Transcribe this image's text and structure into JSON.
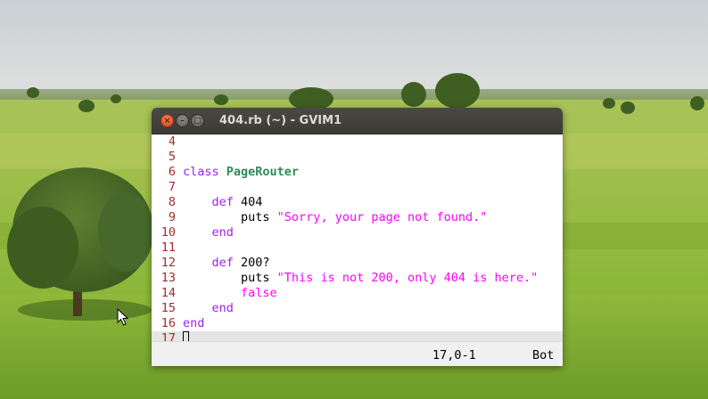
{
  "window": {
    "title": "404.rb (~) - GVIM1",
    "close_symbol": "×",
    "minimize_symbol": "–",
    "maximize_symbol": "□"
  },
  "editor": {
    "lines": [
      {
        "num": "4",
        "tokens": []
      },
      {
        "num": "5",
        "tokens": []
      },
      {
        "num": "6",
        "tokens": [
          {
            "t": "class",
            "c": "kw"
          },
          {
            "t": " "
          },
          {
            "t": "PageRouter",
            "c": "cls"
          }
        ]
      },
      {
        "num": "7",
        "tokens": []
      },
      {
        "num": "8",
        "tokens": [
          {
            "t": "    "
          },
          {
            "t": "def",
            "c": "kw"
          },
          {
            "t": " 404"
          }
        ]
      },
      {
        "num": "9",
        "tokens": [
          {
            "t": "        puts "
          },
          {
            "t": "\"Sorry, your page not found.\"",
            "c": "str"
          }
        ]
      },
      {
        "num": "10",
        "tokens": [
          {
            "t": "    "
          },
          {
            "t": "end",
            "c": "kw"
          }
        ]
      },
      {
        "num": "11",
        "tokens": []
      },
      {
        "num": "12",
        "tokens": [
          {
            "t": "    "
          },
          {
            "t": "def",
            "c": "kw"
          },
          {
            "t": " 200?"
          }
        ]
      },
      {
        "num": "13",
        "tokens": [
          {
            "t": "        puts "
          },
          {
            "t": "\"This is not 200, only 404 is here.\"",
            "c": "str"
          }
        ]
      },
      {
        "num": "14",
        "tokens": [
          {
            "t": "        "
          },
          {
            "t": "false",
            "c": "bool"
          }
        ]
      },
      {
        "num": "15",
        "tokens": [
          {
            "t": "    "
          },
          {
            "t": "end",
            "c": "kw"
          }
        ]
      },
      {
        "num": "16",
        "tokens": [
          {
            "t": "end",
            "c": "kw"
          }
        ]
      },
      {
        "num": "17",
        "tokens": [],
        "cursor": true
      }
    ]
  },
  "statusbar": {
    "position": "17,0-1",
    "scroll": "Bot"
  },
  "colors": {
    "keyword": "#a020f0",
    "class_name": "#2e8b57",
    "string": "#ff00ff",
    "line_number": "#a52a2a",
    "titlebar": "#3c3b37",
    "close_button": "#e95420"
  },
  "icons": {
    "pointer": "mouse-pointer-icon"
  }
}
